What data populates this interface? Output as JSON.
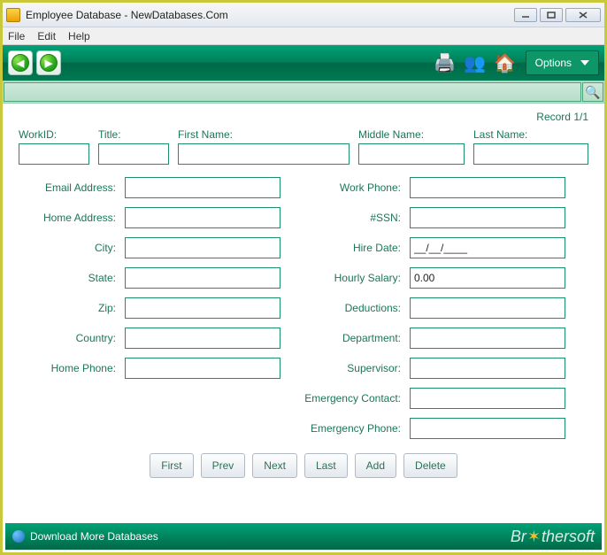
{
  "window": {
    "title": "Employee Database - NewDatabases.Com"
  },
  "menu": {
    "file": "File",
    "edit": "Edit",
    "help": "Help"
  },
  "toolbar": {
    "options": "Options"
  },
  "record_counter": "Record 1/1",
  "top_fields": {
    "workid_label": "WorkID:",
    "title_label": "Title:",
    "firstname_label": "First Name:",
    "middlename_label": "Middle Name:",
    "lastname_label": "Last Name:",
    "workid": "",
    "title": "",
    "firstname": "",
    "middlename": "",
    "lastname": ""
  },
  "left": {
    "email_label": "Email Address:",
    "email": "",
    "homeaddr_label": "Home Address:",
    "homeaddr": "",
    "city_label": "City:",
    "city": "",
    "state_label": "State:",
    "state": "",
    "zip_label": "Zip:",
    "zip": "",
    "country_label": "Country:",
    "country": "",
    "homephone_label": "Home Phone:",
    "homephone": ""
  },
  "right": {
    "workphone_label": "Work Phone:",
    "workphone": "",
    "ssn_label": "#SSN:",
    "ssn": "",
    "hiredate_label": "Hire Date:",
    "hiredate": "__/__/____",
    "hourly_label": "Hourly Salary:",
    "hourly": "0.00",
    "deductions_label": "Deductions:",
    "deductions": "",
    "department_label": "Department:",
    "department": "",
    "supervisor_label": "Supervisor:",
    "supervisor": "",
    "emcontact_label": "Emergency Contact:",
    "emcontact": "",
    "emphone_label": "Emergency Phone:",
    "emphone": ""
  },
  "nav": {
    "first": "First",
    "prev": "Prev",
    "next": "Next",
    "last": "Last",
    "add": "Add",
    "delete": "Delete"
  },
  "footer": {
    "download": "Download More Databases",
    "brand_pre": "Br",
    "brand_post": "thersoft"
  }
}
